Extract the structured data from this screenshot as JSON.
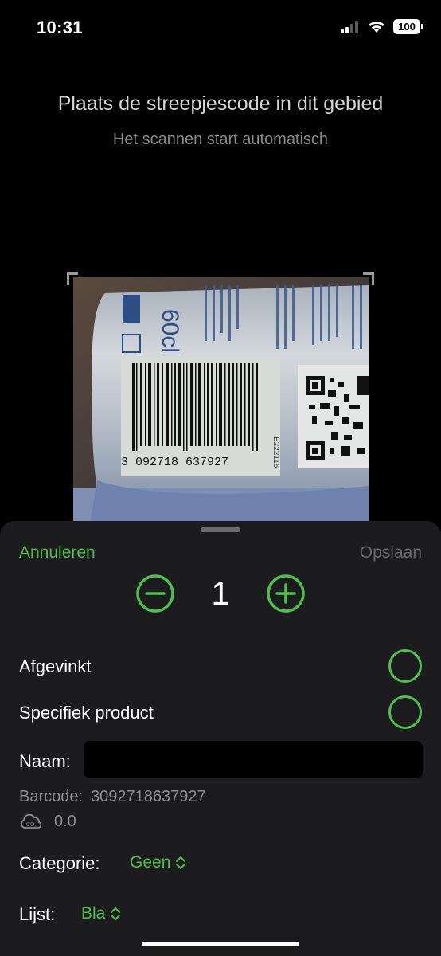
{
  "status_bar": {
    "time": "10:31",
    "battery": "100"
  },
  "scanner": {
    "title": "Plaats de streepjescode in dit gebied",
    "subtitle": "Het scannen start automatisch",
    "can_text": {
      "volume": "60cl",
      "barcode_digits": "3 092718 637927",
      "lot_code": "E222116"
    }
  },
  "sheet": {
    "cancel_label": "Annuleren",
    "save_label": "Opslaan",
    "quantity": "1",
    "checked_label": "Afgevinkt",
    "specific_label": "Specifiek product",
    "name_label": "Naam:",
    "name_value": "",
    "barcode_label": "Barcode:",
    "barcode_value": "3092718637927",
    "co2_value": "0.0",
    "category_label": "Categorie:",
    "category_value": "Geen",
    "list_label": "Lijst:",
    "list_value": "Bla"
  },
  "icons": {
    "minus": "minus-circle-icon",
    "plus": "plus-circle-icon",
    "co2": "co2-cloud-icon",
    "chevron": "chevron-up-down-icon"
  },
  "colors": {
    "accent": "#4cc04a",
    "sheet_bg": "#1c1c1e",
    "secondary_text": "#8e8e93",
    "disabled": "#6a6a6e"
  }
}
